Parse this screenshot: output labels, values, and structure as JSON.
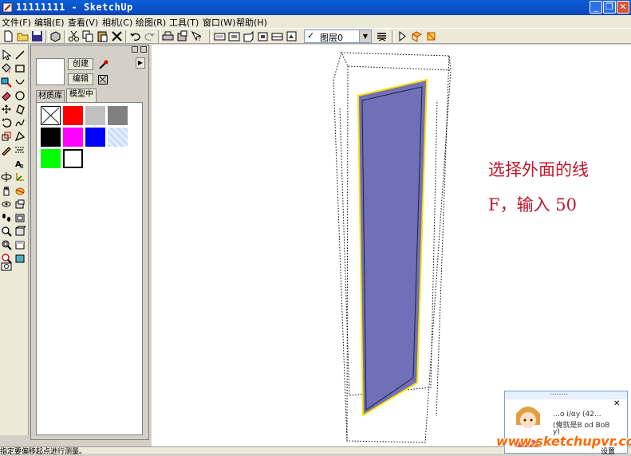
{
  "window": {
    "title": "11111111 - SketchUp",
    "minimize": "_",
    "restore": "❐",
    "close": "✕"
  },
  "menu": [
    "文件(F)",
    "编辑(E)",
    "查看(V)",
    "相机(C)",
    "绘图(R)",
    "工具(T)",
    "窗口(W)",
    "帮助(H)"
  ],
  "toolbar": {
    "layer_check": "✓",
    "layer_value": "图层0",
    "layer_arrow": "▼"
  },
  "materials": {
    "create_label": "创建",
    "edit_label": "编辑",
    "expand_arrow": "▶",
    "tabs": [
      "材质库",
      "模型中"
    ],
    "active_tab": "模型中",
    "swatches": [
      {
        "name": "default",
        "color": "#ffffff"
      },
      {
        "name": "red",
        "color": "#ff0000"
      },
      {
        "name": "light-gray",
        "color": "#c0c0c0"
      },
      {
        "name": "gray",
        "color": "#808080"
      },
      {
        "name": "black",
        "color": "#000000"
      },
      {
        "name": "magenta",
        "color": "#ff00ff"
      },
      {
        "name": "blue",
        "color": "#0000ff"
      },
      {
        "name": "light-blue",
        "color": "#c8dcff"
      },
      {
        "name": "green",
        "color": "#00ff00"
      },
      {
        "name": "white",
        "color": "#ffffff"
      }
    ]
  },
  "viewport": {
    "annotation_line1": "选择外面的线",
    "annotation_line2": "F，输入 50",
    "face_color": "#7070b8",
    "selection_color": "#ffe000"
  },
  "status": {
    "text": "指定要偏移起点进行测量。"
  },
  "popup": {
    "dots": "........",
    "close": "✕",
    "line1": "…o i/αy (42...",
    "line2": "(俺就是B od BoB",
    "line3": "y)",
    "settings": "设置"
  },
  "watermark": "www.sketchupvr.com"
}
